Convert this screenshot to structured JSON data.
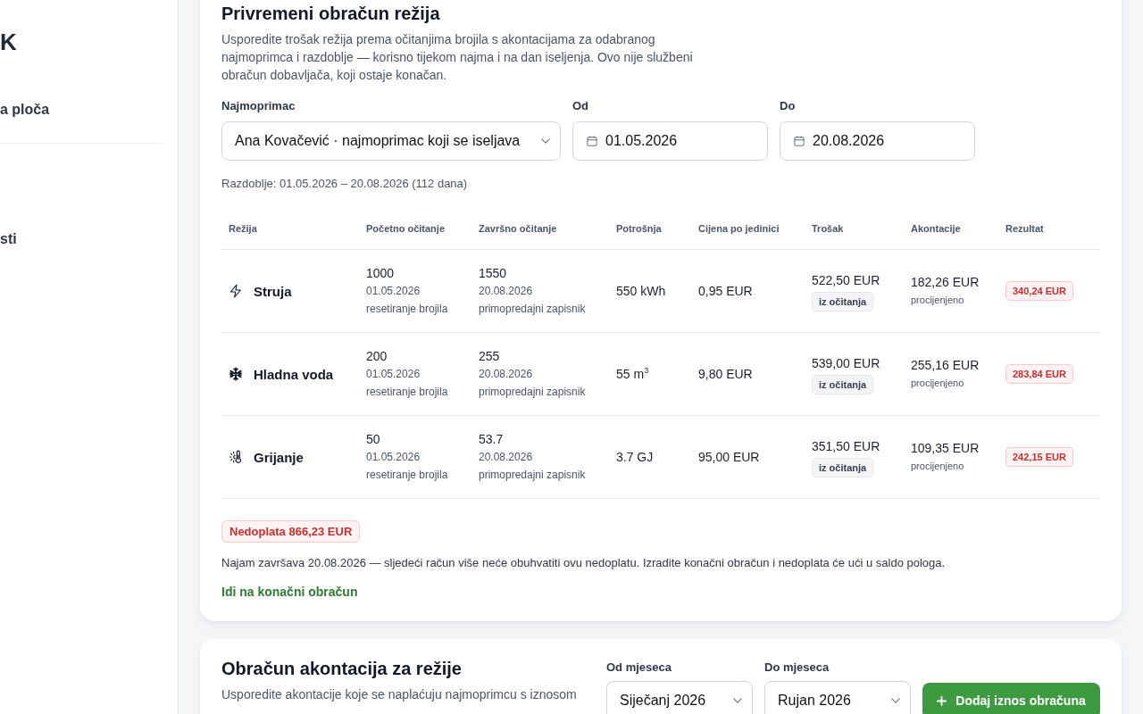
{
  "sidebar": {
    "logo": "K",
    "items": [
      {
        "label": "a ploča"
      },
      {
        "label": "sti"
      }
    ]
  },
  "interim_settlement": {
    "title": "Privremeni obračun režija",
    "description": "Usporedite trošak režija prema očitanjima brojila s akontacijama za odabranog najmoprimca i razdoblje — korisno tijekom najma i na dan iseljenja. Ovo nije službeni obračun dobavljača, koji ostaje konačan.",
    "filters": [
      {
        "kind": "select",
        "label": "Najmoprimac",
        "value": "Ana Kovačević · najmoprimac koji se iseljava"
      },
      {
        "kind": "date",
        "label": "Od",
        "value": "01.05.2026"
      },
      {
        "kind": "date",
        "label": "Do",
        "value": "20.08.2026"
      }
    ],
    "period": "Razdoblje: 01.05.2026 – 20.08.2026 (112 dana)",
    "table": {
      "columns": [
        "Režija",
        "Početno očitanje",
        "Završno očitanje",
        "Potrošnja",
        "Cijena po jedinici",
        "Trošak",
        "Akontacije",
        "Rezultat"
      ],
      "rows": [
        {
          "kind": "electricity",
          "utility": "Struja",
          "start_reading": {
            "value": "1000",
            "date": "01.05.2026",
            "note": "resetiranje brojila"
          },
          "end_reading": {
            "value": "1550",
            "date": "20.08.2026",
            "note": "primopredajni zapisnik"
          },
          "consumption": "550 kWh",
          "unit_price": "0,95 EUR",
          "cost": {
            "value": "522,50 EUR",
            "source": "iz očitanja"
          },
          "advances": {
            "value": "182,26 EUR",
            "note": "procijenjeno"
          },
          "result": "340,24 EUR"
        },
        {
          "kind": "water",
          "utility": "Hladna voda",
          "start_reading": {
            "value": "200",
            "date": "01.05.2026",
            "note": "resetiranje brojila"
          },
          "end_reading": {
            "value": "255",
            "date": "20.08.2026",
            "note": "primopredajni zapisnik"
          },
          "consumption": "55 m$^{3}$",
          "unit_price": "9,80 EUR",
          "cost": {
            "value": "539,00 EUR",
            "source": "iz očitanja"
          },
          "advances": {
            "value": "255,16 EUR",
            "note": "procijenjeno"
          },
          "result": "283,84 EUR"
        },
        {
          "kind": "heating",
          "utility": "Grijanje",
          "start_reading": {
            "value": "50",
            "date": "01.05.2026",
            "note": "resetiranje brojila"
          },
          "end_reading": {
            "value": "53.7",
            "date": "20.08.2026",
            "note": "primopredajni zapisnik"
          },
          "consumption": "3.7 GJ",
          "unit_price": "95,00 EUR",
          "cost": {
            "value": "351,50 EUR",
            "source": "iz očitanja"
          },
          "advances": {
            "value": "109,35 EUR",
            "note": "procijenjeno"
          },
          "result": "242,15 EUR"
        }
      ]
    },
    "balance_badge": "Nedoplata 866,23 EUR",
    "notice": "Najam završava 20.08.2026 — sljedeći račun više neće obuhvatiti ovu nedoplatu. Izradite konačni obračun i nedoplata će ući u saldo pologa.",
    "link": "Idi na konačni obračun"
  },
  "advance_settlement": {
    "title": "Obračun akontacija za režije",
    "description": "Usporedite akontacije koje se naplaćuju najmoprimcu s iznosom",
    "filters": [
      {
        "kind": "select",
        "label": "Od mjeseca",
        "value": "Siječanj 2026"
      },
      {
        "kind": "select",
        "label": "Do mjeseca",
        "value": "Rujan 2026"
      }
    ],
    "add_button": "Dodaj iznos obračuna"
  }
}
